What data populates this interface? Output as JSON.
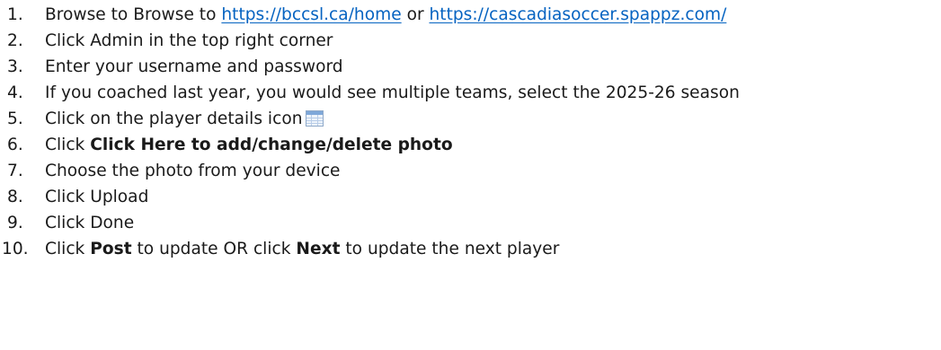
{
  "steps": [
    {
      "num": "1.",
      "before": "Browse to Browse to ",
      "link1": "https://bccsl.ca/home",
      "between": " or ",
      "link2": "https://cascadiasoccer.spappz.com/"
    },
    {
      "num": "2.",
      "text": "Click Admin in the top right corner"
    },
    {
      "num": "3.",
      "text": "Enter your username and password"
    },
    {
      "num": "4.",
      "text": "If you coached last year, you would see multiple teams, select the 2025-26 season"
    },
    {
      "num": "5.",
      "text": "Click on the player details icon",
      "icon": "player-details-icon"
    },
    {
      "num": "6.",
      "before": "Click ",
      "bold": "Click Here to add/change/delete photo"
    },
    {
      "num": "7.",
      "text": "Choose the photo from your device"
    },
    {
      "num": "8.",
      "text": "Click Upload"
    },
    {
      "num": "9.",
      "text": "Click Done"
    },
    {
      "num": "10.",
      "before": "Click ",
      "bold1": "Post",
      "middle": " to update OR click ",
      "bold2": "Next",
      "after": " to update the next player"
    }
  ],
  "colors": {
    "link": "#0563c1",
    "text": "#1a1a1a",
    "icon_header": "#7fa8d9",
    "icon_grid": "#b9cde8"
  }
}
